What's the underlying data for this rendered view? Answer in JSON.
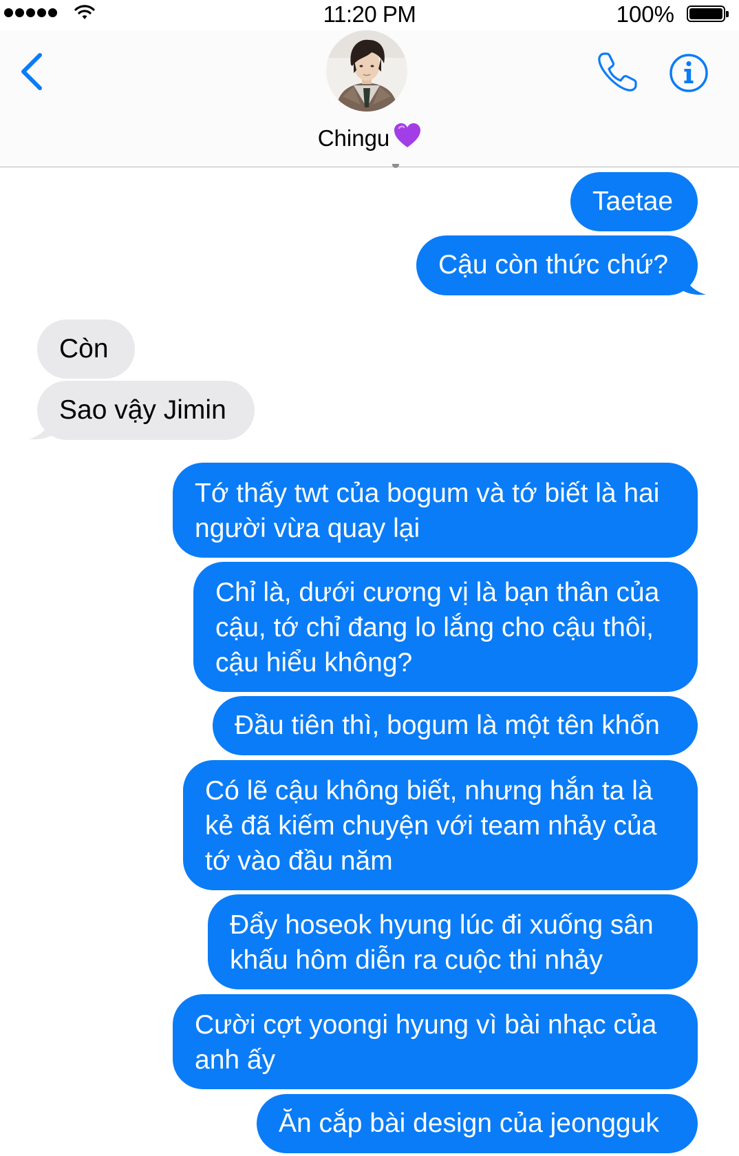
{
  "status_bar": {
    "time": "11:20 PM",
    "battery_percent": "100%",
    "signal_bars": 5,
    "icons": [
      "signal-dots-icon",
      "wifi-icon",
      "battery-icon"
    ]
  },
  "header": {
    "contact_name": "Chingu",
    "contact_emoji": "purple-heart-icon",
    "buttons": [
      "back-chevron-icon",
      "phone-icon",
      "info-icon"
    ],
    "accent_color": "#0a7cf7"
  },
  "messages": [
    {
      "from": "me",
      "lines": [
        "Taetae"
      ]
    },
    {
      "from": "me",
      "lines": [
        "Cậu còn thức chứ?"
      ]
    },
    {
      "from": "them",
      "lines": [
        "Còn"
      ]
    },
    {
      "from": "them",
      "lines": [
        "Sao vậy Jimin"
      ]
    },
    {
      "from": "me",
      "lines": [
        "Tớ thấy twt của bogum và tớ biết là hai",
        "người vừa quay lại"
      ]
    },
    {
      "from": "me",
      "lines": [
        "Chỉ là, dưới cương vị là bạn thân của",
        "cậu, tớ chỉ đang lo lắng cho cậu thôi,",
        "cậu hiểu không?"
      ]
    },
    {
      "from": "me",
      "lines": [
        "Đầu tiên thì, bogum là một tên khốn"
      ]
    },
    {
      "from": "me",
      "lines": [
        "Có lẽ cậu không biết, nhưng hắn ta là",
        "kẻ đã kiếm chuyện với team nhảy của",
        "tớ vào đầu năm"
      ]
    },
    {
      "from": "me",
      "lines": [
        "Đẩy hoseok hyung lúc đi xuống sân",
        "khấu hôm diễn ra cuộc thi nhảy"
      ]
    },
    {
      "from": "me",
      "lines": [
        "Cười cợt yoongi hyung vì bài nhạc của",
        "anh ấy"
      ]
    },
    {
      "from": "me",
      "lines": [
        "Ăn cắp bài design của jeongguk"
      ]
    }
  ],
  "colors": {
    "sent_bubble": "#0a7cf7",
    "received_bubble": "#e9e9eb",
    "sent_text": "#ffffff",
    "received_text": "#000000"
  }
}
